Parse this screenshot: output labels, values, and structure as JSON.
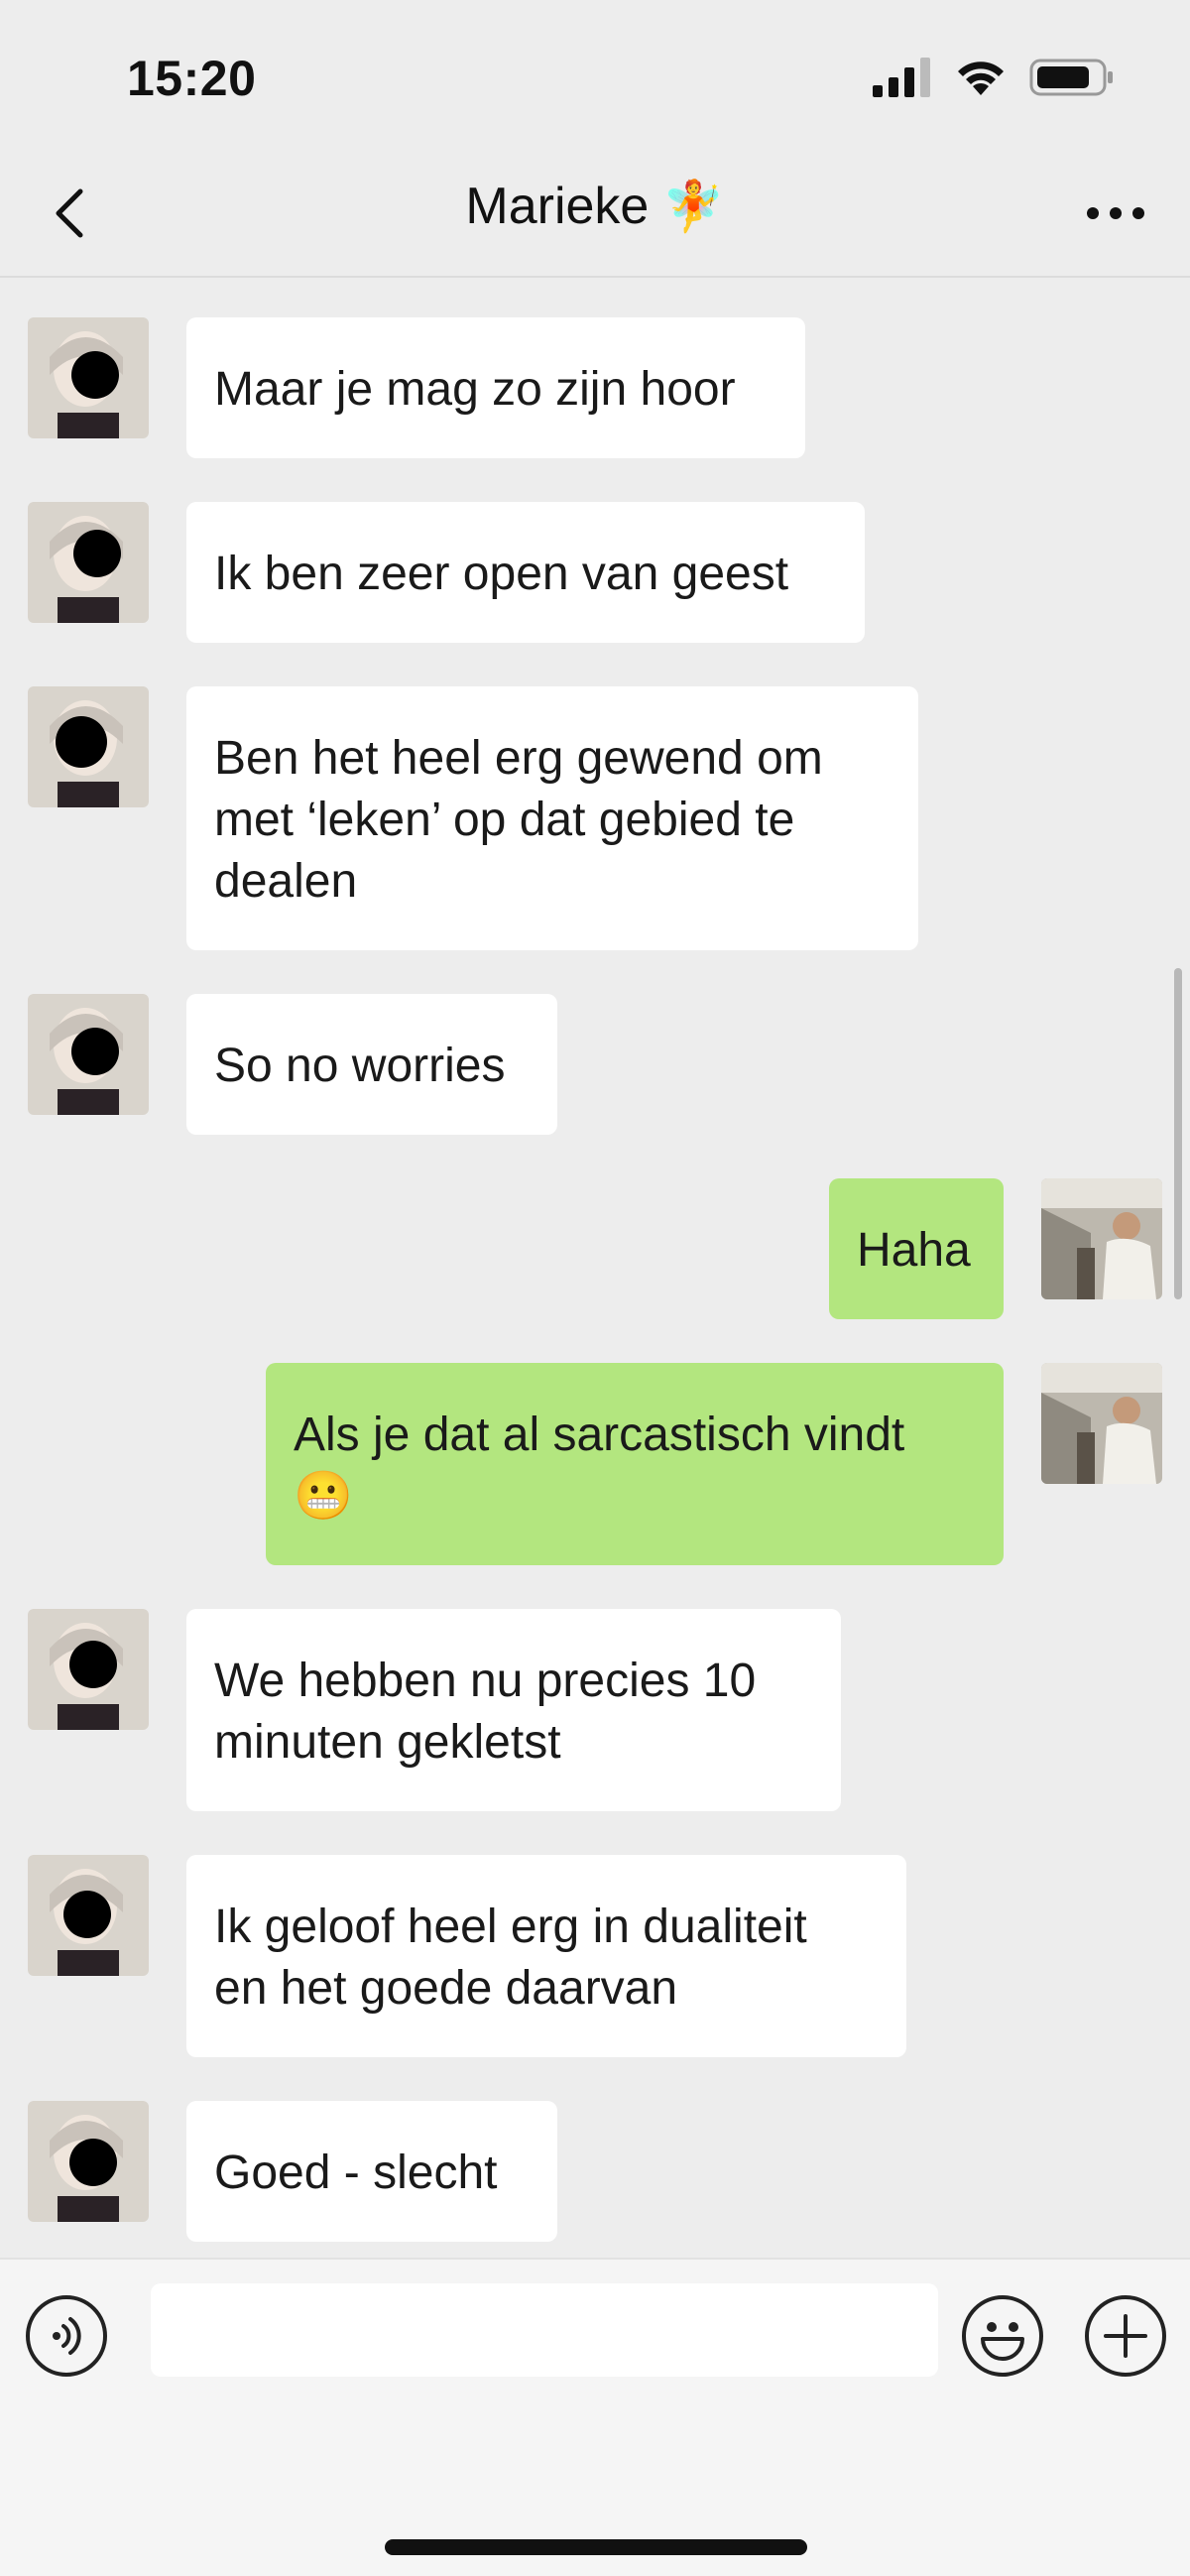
{
  "status_bar": {
    "time": "15:20"
  },
  "header": {
    "title": "Marieke",
    "title_emoji": "🧚",
    "back_icon": "chevron-left-icon",
    "more_icon": "ellipsis-icon"
  },
  "messages": [
    {
      "direction": "in",
      "text": "Maar je mag zo zijn hoor"
    },
    {
      "direction": "in",
      "text": "Ik ben zeer open van geest"
    },
    {
      "direction": "in",
      "lines": [
        "Ben het heel erg gewend om",
        "met ‘leken’ op dat gebied te",
        "dealen"
      ]
    },
    {
      "direction": "in",
      "text": "So no worries"
    },
    {
      "direction": "out",
      "text": "Haha"
    },
    {
      "direction": "out",
      "lines": [
        "Als je dat al sarcastisch vindt",
        "😬"
      ]
    },
    {
      "direction": "in",
      "lines": [
        "We hebben nu precies 10",
        "minuten gekletst"
      ]
    },
    {
      "direction": "in",
      "lines": [
        "Ik geloof heel erg in dualiteit",
        "en het goede daarvan"
      ]
    },
    {
      "direction": "in",
      "text": "Goed - slecht"
    }
  ],
  "composer": {
    "input_value": "",
    "voice_icon": "voice-icon",
    "emoji_icon": "smiley-icon",
    "plus_icon": "plus-icon"
  },
  "colors": {
    "background": "#ededed",
    "incoming_bubble": "#ffffff",
    "outgoing_bubble": "#b3e67f"
  }
}
